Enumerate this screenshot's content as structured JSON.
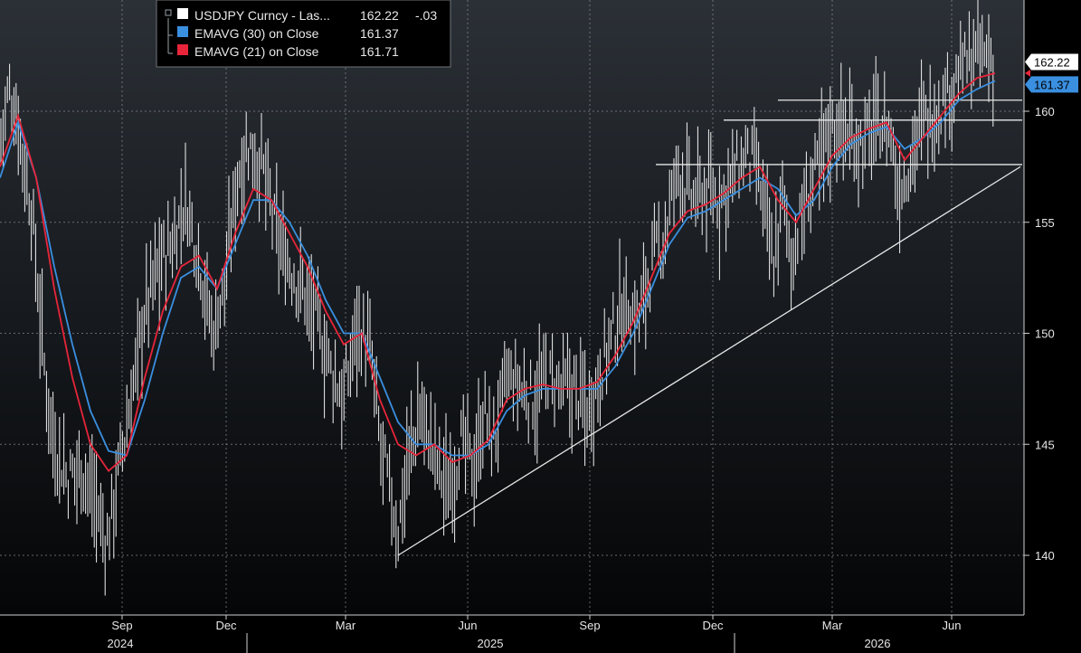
{
  "chart_data": {
    "type": "line",
    "legend": [
      {
        "name": "USDJPY Curncy - Las...",
        "value": "162.22",
        "change": "-.03",
        "color": "#ffffff"
      },
      {
        "name": "EMAVG (30)  on Close",
        "value": "161.37",
        "change": "",
        "color": "#3a8fe0"
      },
      {
        "name": "EMAVG (21)  on Close",
        "value": "161.71",
        "change": "",
        "color": "#e8253a"
      }
    ],
    "ylim": [
      136,
      164
    ],
    "yticks": [
      140,
      145,
      150,
      155,
      160
    ],
    "months": [
      "Sep",
      "Dec",
      "Mar",
      "Jun",
      "Sep",
      "Dec",
      "Mar",
      "Jun"
    ],
    "years": [
      "2024",
      "2025",
      "2026"
    ],
    "last_price_tag": "162.22",
    "ema30_tag": "161.37",
    "price_keypoints": [
      [
        0,
        158.5
      ],
      [
        10,
        161.0
      ],
      [
        20,
        159.5
      ],
      [
        35,
        155.5
      ],
      [
        50,
        148.0
      ],
      [
        60,
        145.0
      ],
      [
        75,
        143.5
      ],
      [
        90,
        144.0
      ],
      [
        105,
        142.5
      ],
      [
        118,
        140.5
      ],
      [
        130,
        143.5
      ],
      [
        145,
        147.0
      ],
      [
        160,
        151.0
      ],
      [
        175,
        153.0
      ],
      [
        190,
        154.0
      ],
      [
        205,
        156.0
      ],
      [
        220,
        153.5
      ],
      [
        235,
        150.0
      ],
      [
        250,
        152.5
      ],
      [
        262,
        157.0
      ],
      [
        275,
        158.5
      ],
      [
        290,
        157.5
      ],
      [
        305,
        154.5
      ],
      [
        320,
        153.0
      ],
      [
        335,
        152.0
      ],
      [
        350,
        150.5
      ],
      [
        365,
        148.5
      ],
      [
        380,
        147.0
      ],
      [
        395,
        150.5
      ],
      [
        410,
        149.0
      ],
      [
        420,
        145.0
      ],
      [
        430,
        143.0
      ],
      [
        440,
        141.0
      ],
      [
        450,
        144.0
      ],
      [
        465,
        146.5
      ],
      [
        480,
        144.5
      ],
      [
        495,
        143.0
      ],
      [
        510,
        145.0
      ],
      [
        525,
        144.0
      ],
      [
        535,
        146.5
      ],
      [
        545,
        145.0
      ],
      [
        560,
        148.0
      ],
      [
        575,
        147.5
      ],
      [
        590,
        147.0
      ],
      [
        605,
        148.0
      ],
      [
        620,
        147.5
      ],
      [
        635,
        147.5
      ],
      [
        650,
        146.5
      ],
      [
        665,
        148.5
      ],
      [
        678,
        150.0
      ],
      [
        690,
        151.5
      ],
      [
        705,
        150.5
      ],
      [
        720,
        153.0
      ],
      [
        735,
        154.5
      ],
      [
        750,
        157.5
      ],
      [
        765,
        156.0
      ],
      [
        780,
        156.5
      ],
      [
        795,
        156.0
      ],
      [
        810,
        157.0
      ],
      [
        825,
        158.0
      ],
      [
        835,
        157.5
      ],
      [
        845,
        155.5
      ],
      [
        855,
        153.0
      ],
      [
        865,
        156.0
      ],
      [
        875,
        153.5
      ],
      [
        885,
        155.0
      ],
      [
        895,
        156.5
      ],
      [
        905,
        157.5
      ],
      [
        915,
        159.0
      ],
      [
        925,
        159.5
      ],
      [
        940,
        159.0
      ],
      [
        955,
        158.5
      ],
      [
        970,
        159.5
      ],
      [
        985,
        159.0
      ],
      [
        992,
        156.5
      ],
      [
        1000,
        157.0
      ],
      [
        1010,
        158.5
      ],
      [
        1020,
        159.5
      ],
      [
        1035,
        160.0
      ],
      [
        1050,
        161.0
      ],
      [
        1065,
        162.0
      ],
      [
        1080,
        162.5
      ],
      [
        1090,
        162.5
      ],
      [
        1100,
        162.2
      ]
    ],
    "ema30_keypoints": [
      [
        0,
        157.0
      ],
      [
        20,
        159.5
      ],
      [
        40,
        157.0
      ],
      [
        60,
        153.0
      ],
      [
        80,
        149.5
      ],
      [
        100,
        146.5
      ],
      [
        120,
        144.7
      ],
      [
        140,
        144.5
      ],
      [
        160,
        147.0
      ],
      [
        180,
        150.0
      ],
      [
        200,
        152.5
      ],
      [
        220,
        153.0
      ],
      [
        240,
        152.0
      ],
      [
        260,
        154.0
      ],
      [
        280,
        156.0
      ],
      [
        300,
        156.0
      ],
      [
        320,
        155.0
      ],
      [
        340,
        153.5
      ],
      [
        360,
        151.5
      ],
      [
        380,
        150.0
      ],
      [
        400,
        150.0
      ],
      [
        420,
        148.0
      ],
      [
        440,
        146.0
      ],
      [
        460,
        145.0
      ],
      [
        480,
        145.0
      ],
      [
        500,
        144.5
      ],
      [
        520,
        144.5
      ],
      [
        540,
        145.0
      ],
      [
        560,
        146.5
      ],
      [
        580,
        147.2
      ],
      [
        600,
        147.5
      ],
      [
        620,
        147.5
      ],
      [
        640,
        147.5
      ],
      [
        660,
        147.5
      ],
      [
        680,
        148.5
      ],
      [
        700,
        150.0
      ],
      [
        720,
        152.0
      ],
      [
        740,
        154.0
      ],
      [
        760,
        155.2
      ],
      [
        780,
        155.5
      ],
      [
        800,
        156.0
      ],
      [
        820,
        156.5
      ],
      [
        840,
        157.0
      ],
      [
        860,
        156.5
      ],
      [
        880,
        155.3
      ],
      [
        900,
        156.0
      ],
      [
        920,
        157.5
      ],
      [
        940,
        158.5
      ],
      [
        960,
        159.0
      ],
      [
        980,
        159.3
      ],
      [
        1000,
        158.3
      ],
      [
        1020,
        158.8
      ],
      [
        1040,
        159.5
      ],
      [
        1060,
        160.5
      ],
      [
        1080,
        161.0
      ],
      [
        1100,
        161.37
      ]
    ],
    "ema21_keypoints": [
      [
        0,
        157.5
      ],
      [
        20,
        159.8
      ],
      [
        40,
        157.0
      ],
      [
        60,
        152.0
      ],
      [
        80,
        148.0
      ],
      [
        100,
        145.0
      ],
      [
        120,
        143.8
      ],
      [
        140,
        144.5
      ],
      [
        160,
        148.0
      ],
      [
        180,
        151.0
      ],
      [
        200,
        153.0
      ],
      [
        220,
        153.5
      ],
      [
        240,
        152.0
      ],
      [
        260,
        154.5
      ],
      [
        280,
        156.5
      ],
      [
        300,
        156.0
      ],
      [
        320,
        154.5
      ],
      [
        340,
        153.0
      ],
      [
        360,
        151.0
      ],
      [
        380,
        149.5
      ],
      [
        400,
        150.0
      ],
      [
        420,
        147.0
      ],
      [
        440,
        145.0
      ],
      [
        460,
        144.5
      ],
      [
        480,
        145.0
      ],
      [
        500,
        144.2
      ],
      [
        520,
        144.5
      ],
      [
        540,
        145.2
      ],
      [
        560,
        147.0
      ],
      [
        580,
        147.5
      ],
      [
        600,
        147.7
      ],
      [
        620,
        147.5
      ],
      [
        640,
        147.5
      ],
      [
        660,
        147.8
      ],
      [
        680,
        149.0
      ],
      [
        700,
        150.5
      ],
      [
        720,
        152.5
      ],
      [
        740,
        154.5
      ],
      [
        760,
        155.5
      ],
      [
        780,
        155.8
      ],
      [
        800,
        156.3
      ],
      [
        820,
        157.0
      ],
      [
        840,
        157.5
      ],
      [
        860,
        156.0
      ],
      [
        880,
        155.0
      ],
      [
        900,
        156.5
      ],
      [
        920,
        158.0
      ],
      [
        940,
        158.8
      ],
      [
        960,
        159.2
      ],
      [
        980,
        159.5
      ],
      [
        1000,
        157.8
      ],
      [
        1020,
        158.8
      ],
      [
        1040,
        159.8
      ],
      [
        1060,
        160.8
      ],
      [
        1080,
        161.5
      ],
      [
        1100,
        161.71
      ]
    ],
    "trendline": {
      "x1": 440,
      "y1": 140.0,
      "x2": 1128,
      "y2": 157.5
    },
    "resistance_lines": [
      {
        "x1": 860,
        "x2": 1130,
        "y": 160.5
      },
      {
        "x1": 800,
        "x2": 1130,
        "y": 159.6
      },
      {
        "x1": 725,
        "x2": 1130,
        "y": 157.6
      }
    ]
  }
}
